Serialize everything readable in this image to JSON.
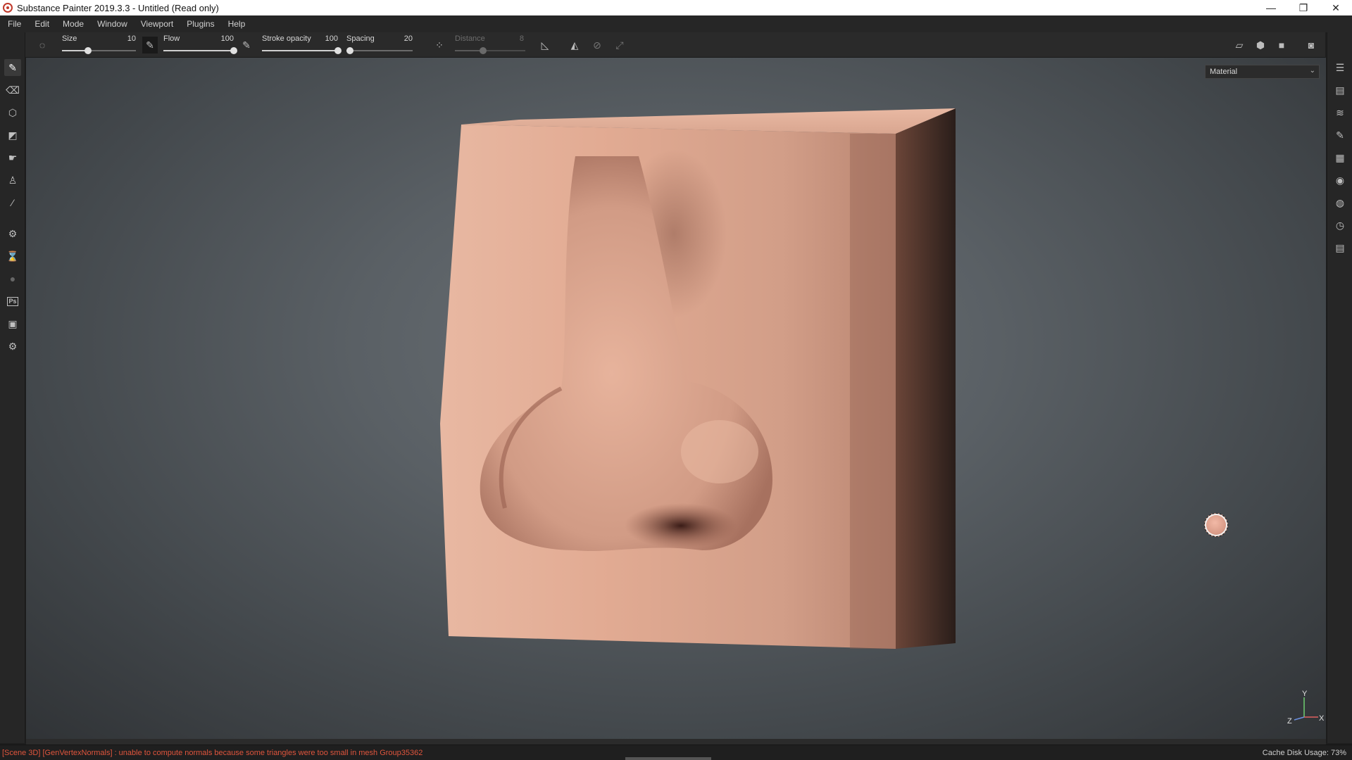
{
  "window": {
    "title": "Substance Painter 2019.3.3 - Untitled (Read only)",
    "controls": {
      "minimize": "—",
      "restore": "❐",
      "close": "✕"
    }
  },
  "menu": [
    "File",
    "Edit",
    "Mode",
    "Window",
    "Viewport",
    "Plugins",
    "Help"
  ],
  "tool_options": {
    "size": {
      "label": "Size",
      "value": "10",
      "fraction": 0.35
    },
    "flow": {
      "label": "Flow",
      "value": "100",
      "fraction": 1.0
    },
    "stroke_opacity": {
      "label": "Stroke opacity",
      "value": "100",
      "fraction": 1.0
    },
    "spacing": {
      "label": "Spacing",
      "value": "20",
      "fraction": 0.05
    },
    "distance": {
      "label": "Distance",
      "value": "8",
      "fraction": 0.4,
      "disabled": true
    }
  },
  "viewport": {
    "channel_select": "Material",
    "axis": {
      "x": "X",
      "y": "Y",
      "z": "Z"
    }
  },
  "status": {
    "error": "[Scene 3D] [GenVertexNormals] : unable to compute normals because some triangles were too small in mesh Group35362",
    "cache": "Cache Disk Usage:   73%"
  },
  "colors": {
    "error_text": "#e0553d",
    "skin": "#e6ad95",
    "background": "#5a6065"
  },
  "icons": {
    "left": [
      "paint-brush-icon",
      "eraser-icon",
      "projection-icon",
      "geometry-fill-icon",
      "smudge-icon",
      "clone-stamp-icon",
      "color-picker-icon",
      "settings-icon",
      "bake-icon",
      "sphere-icon",
      "photoshop-icon",
      "export-icon",
      "plugin-icon"
    ],
    "right": [
      "layers-panel-icon",
      "texture-set-icon",
      "layer-stack-icon",
      "properties-icon",
      "shelf-icon",
      "display-settings-icon",
      "environment-icon",
      "history-icon",
      "log-icon"
    ]
  }
}
